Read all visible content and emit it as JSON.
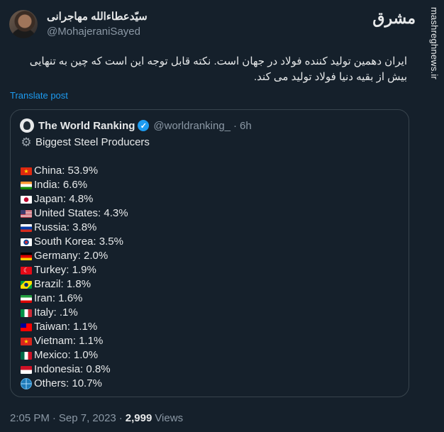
{
  "watermark": {
    "logo_text": "مشرق",
    "url": "mashreghnews.ir"
  },
  "author": {
    "name": "سیّدعطاءالله مهاجرانی",
    "handle": "@MohajeraniSayed"
  },
  "tweet": {
    "text": "ایران دهمین تولید کننده فولاد  در جهان است. نکته قابل توجه این است که چین به تنهایی بیش از بقیه دنیا فولاد تولید می کند.",
    "translate_label": "Translate post"
  },
  "quote": {
    "name": "The World Ranking",
    "handle": "@worldranking_",
    "dot": "·",
    "time": "6h",
    "title": "Biggest Steel Producers",
    "items": [
      {
        "flag": "cn-flag-icon",
        "label": "China: 53.9%"
      },
      {
        "flag": "in-flag-icon",
        "label": "India: 6.6%"
      },
      {
        "flag": "jp-flag-icon",
        "label": "Japan: 4.8%"
      },
      {
        "flag": "us-flag-icon",
        "label": "United States: 4.3%"
      },
      {
        "flag": "ru-flag-icon",
        "label": "Russia: 3.8%"
      },
      {
        "flag": "kr-flag-icon",
        "label": "South Korea: 3.5%"
      },
      {
        "flag": "de-flag-icon",
        "label": "Germany: 2.0%"
      },
      {
        "flag": "tr-flag-icon",
        "label": "Turkey: 1.9%"
      },
      {
        "flag": "br-flag-icon",
        "label": "Brazil: 1.8%"
      },
      {
        "flag": "ir-flag-icon",
        "label": "Iran: 1.6%"
      },
      {
        "flag": "it-flag-icon",
        "label": "Italy: .1%"
      },
      {
        "flag": "tw-flag-icon",
        "label": "Taiwan: 1.1%"
      },
      {
        "flag": "vn-flag-icon",
        "label": "Vietnam: 1.1%"
      },
      {
        "flag": "mx-flag-icon",
        "label": "Mexico: 1.0%"
      },
      {
        "flag": "id-flag-icon",
        "label": "Indonesia: 0.8%"
      },
      {
        "flag": "globe-icon",
        "label": "Others: 10.7%"
      }
    ]
  },
  "meta": {
    "time": "2:05 PM",
    "separator": "·",
    "date": "Sep 7, 2023",
    "views_count": "2,999",
    "views_label": "Views"
  },
  "colors": {
    "background": "#15202b",
    "link": "#1d9bf0",
    "secondary_text": "#8b98a5",
    "border": "#38444d"
  }
}
